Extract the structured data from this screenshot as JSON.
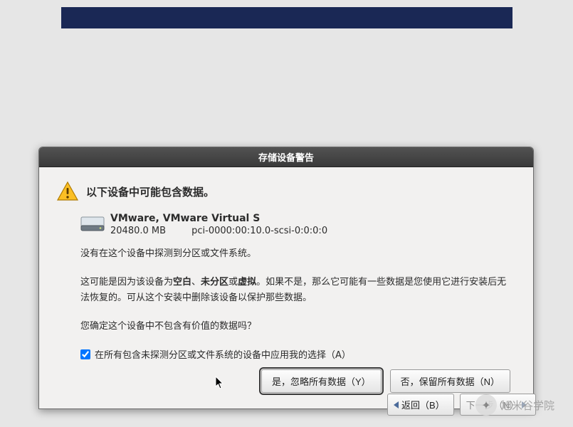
{
  "dialog": {
    "title": "存储设备警告",
    "heading": "以下设备中可能包含数据。",
    "device": {
      "name": "VMware, VMware Virtual S",
      "size": "20480.0 MB",
      "path": "pci-0000:00:10.0-scsi-0:0:0:0"
    },
    "para1": "没有在这个设备中探测到分区或文件系统。",
    "para2_a": "这可能是因为该设备为",
    "para2_blank": "空白",
    "para2_sep1": "、",
    "para2_unpart": "未分区",
    "para2_sep2": "或",
    "para2_virtual": "虚拟",
    "para2_b": "。如果不是，那么它可能有一些数据是您使用它进行安装后无法恢复的。可从这个安装中删除该设备以保护那些数据。",
    "para3": "您确定这个设备中不包含有价值的数据吗？",
    "checkbox_label": "在所有包含未探测分区或文件系统的设备中应用我的选择（A）",
    "btn_yes": "是，忽略所有数据（Y）",
    "btn_no": "否，保留所有数据（N）"
  },
  "nav": {
    "back": "返回（B）",
    "next": "下一步（N）"
  },
  "watermark": {
    "text": "旭米谷学院"
  }
}
